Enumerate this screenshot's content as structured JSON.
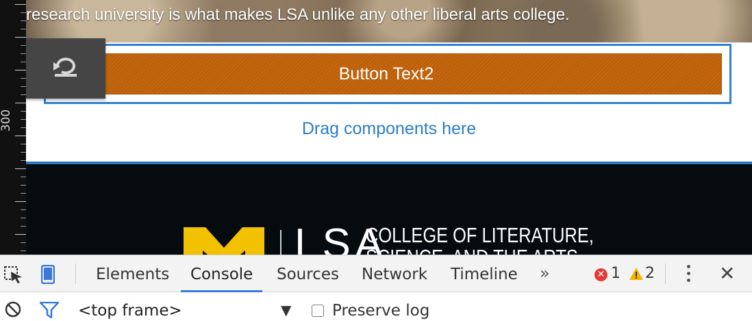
{
  "ruler": {
    "label": "300"
  },
  "hero": {
    "text": "research university is what makes LSA unlike any other liberal arts college."
  },
  "editor": {
    "button_label": "Button Text2",
    "drag_hint": "Drag components here",
    "undo_icon": "undo-icon"
  },
  "footer": {
    "logo_letters": "LSA",
    "college_line1": "COLLEGE OF LITERATURE,",
    "college_line2": "SCIENCE, AND THE ARTS"
  },
  "devtools": {
    "tabs": [
      "Elements",
      "Console",
      "Sources",
      "Network",
      "Timeline"
    ],
    "active_tab": "Console",
    "more": "»",
    "errors": "1",
    "warnings": "2",
    "frame_select": "<top frame>",
    "dropdown_arrow": "▼",
    "preserve_log": "Preserve log",
    "icons": [
      "inspect-icon",
      "device-mode-icon",
      "clear-console-icon",
      "filter-icon",
      "more-options-icon",
      "close-icon"
    ]
  },
  "colors": {
    "accent_blue": "#2f80d0",
    "button_orange": "#c5680f",
    "footer_bg": "#060b10",
    "michigan_maize": "#f2c200"
  }
}
